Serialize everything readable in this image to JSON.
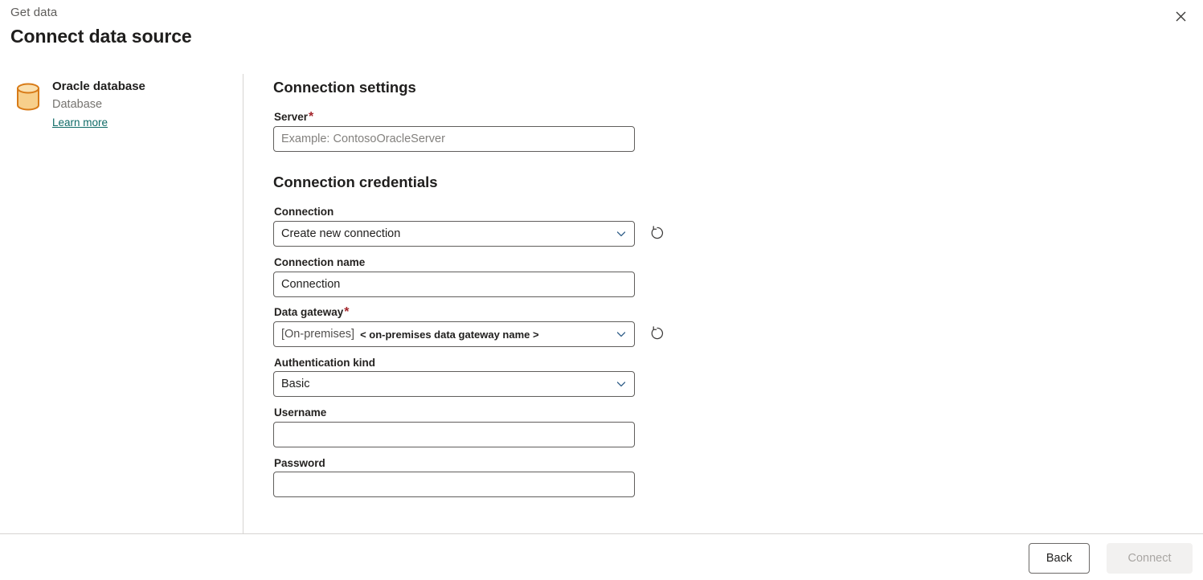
{
  "header": {
    "eyebrow": "Get data",
    "title": "Connect data source",
    "close_icon": "close-icon"
  },
  "source": {
    "icon": "database-cylinder-icon",
    "name": "Oracle database",
    "category": "Database",
    "learn_more": "Learn more",
    "link_color": "#0f6b67",
    "icon_stroke": "#d87b18",
    "icon_fill": "#f7cf8b"
  },
  "sections": {
    "connection_settings": "Connection settings",
    "connection_credentials": "Connection credentials"
  },
  "fields": {
    "server": {
      "label": "Server",
      "required": true,
      "required_mark": "*",
      "value": "",
      "placeholder": "Example: ContosoOracleServer"
    },
    "connection": {
      "label": "Connection",
      "required": false,
      "value": "Create new connection",
      "refresh_icon": "refresh-icon",
      "chevron_icon": "chevron-down-icon"
    },
    "connection_name": {
      "label": "Connection name",
      "required": false,
      "value": "Connection",
      "placeholder": ""
    },
    "data_gateway": {
      "label": "Data gateway",
      "required": true,
      "required_mark": "*",
      "value_prefix": "[On-premises]",
      "value_name": "< on-premises data gateway name >",
      "refresh_icon": "refresh-icon",
      "chevron_icon": "chevron-down-icon"
    },
    "authentication_kind": {
      "label": "Authentication kind",
      "required": false,
      "value": "Basic",
      "chevron_icon": "chevron-down-icon"
    },
    "username": {
      "label": "Username",
      "required": false,
      "value": "",
      "placeholder": ""
    },
    "password": {
      "label": "Password",
      "required": false,
      "value": "",
      "placeholder": ""
    }
  },
  "footer": {
    "back_label": "Back",
    "connect_label": "Connect",
    "connect_disabled": true
  },
  "colors": {
    "required_red": "#a4262c",
    "text_primary": "#1f1e1d",
    "text_secondary": "#75736f",
    "border": "#605e5c",
    "divider": "#d6d4d2"
  }
}
